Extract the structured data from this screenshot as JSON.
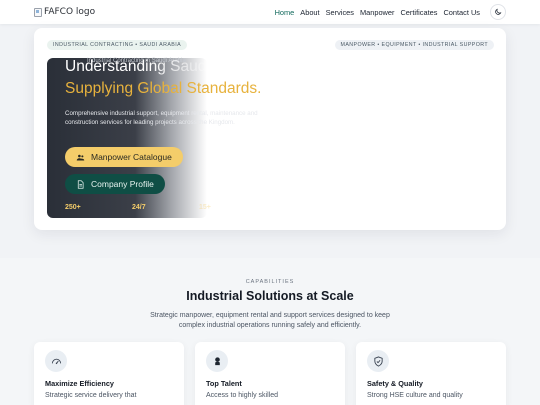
{
  "header": {
    "logo_alt": "FAFCO logo",
    "nav": [
      "Home",
      "About",
      "Services",
      "Manpower",
      "Certificates",
      "Contact Us"
    ],
    "active_nav": "Home",
    "theme_icon": "moon-icon"
  },
  "hero": {
    "pill_left": "INDUSTRIAL CONTRACTING • SAUDI ARABIA",
    "pill_right": "MANPOWER • EQUIPMENT • INDUSTRIAL SUPPORT",
    "eyebrow": "Industrial Contracting in Saudi Arabia",
    "headline_line1": "Understanding Saudi",
    "headline_line2": "Supplying Global Standards.",
    "description": "Comprehensive industrial support, equipment rental, maintenance and construction services for leading projects across the Kingdom.",
    "primary_button": "Manpower Catalogue",
    "secondary_button": "Company Profile",
    "stats": [
      "250+",
      "24/7",
      "15+"
    ]
  },
  "capabilities": {
    "eyebrow": "CAPABILITIES",
    "title": "Industrial Solutions at Scale",
    "description": "Strategic manpower, equipment rental and support services designed to keep complex industrial operations running safely and efficiently.",
    "cards": [
      {
        "title": "Maximize Efficiency",
        "text": "Strategic service delivery that",
        "icon": "gauge-icon"
      },
      {
        "title": "Top Talent",
        "text": "Access to highly skilled",
        "icon": "worker-icon"
      },
      {
        "title": "Safety & Quality",
        "text": "Strong HSE culture and quality",
        "icon": "shield-check-icon"
      }
    ]
  },
  "colors": {
    "accent_green": "#11695c",
    "gold": "#f4cd6a",
    "dark_green": "#0f4e45"
  }
}
